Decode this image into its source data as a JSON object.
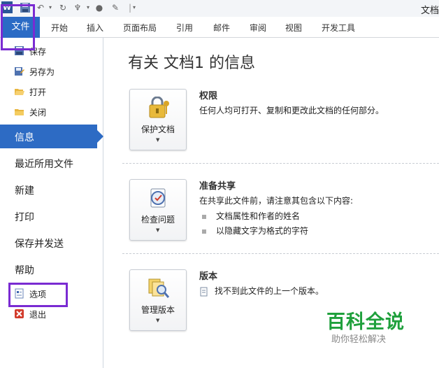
{
  "qat": {
    "icons": [
      "word-logo",
      "save-icon",
      "undo-icon",
      "redo-icon",
      "format-painter-icon",
      "dot-icon",
      "draw-icon",
      "customize-icon"
    ],
    "app_logo_letter": "W",
    "title_fragment": "文档"
  },
  "tabs": {
    "file": "文件",
    "home": "开始",
    "insert": "插入",
    "page_layout": "页面布局",
    "references": "引用",
    "mailings": "邮件",
    "review": "审阅",
    "view": "视图",
    "developer": "开发工具"
  },
  "nav": {
    "save": "保存",
    "save_as": "另存为",
    "open": "打开",
    "close": "关闭",
    "info": "信息",
    "recent": "最近所用文件",
    "new": "新建",
    "print": "打印",
    "save_send": "保存并发送",
    "help": "帮助",
    "options": "选项",
    "exit": "退出"
  },
  "main": {
    "title": "有关 文档1 的信息",
    "permissions": {
      "button": "保护文档",
      "title": "权限",
      "desc": "任何人均可打开、复制和更改此文档的任何部分。"
    },
    "prepare": {
      "button": "检查问题",
      "title": "准备共享",
      "desc": "在共享此文件前，请注意其包含以下内容:",
      "bullets": [
        "文档属性和作者的姓名",
        "以隐藏文字为格式的字符"
      ]
    },
    "versions": {
      "button": "管理版本",
      "title": "版本",
      "desc": "找不到此文件的上一个版本。"
    }
  },
  "watermark": {
    "title": "百科全说",
    "subtitle": "助你轻松解决"
  },
  "colors": {
    "accent": "#2b6bc5",
    "highlight": "#7a2bd2",
    "watermark": "#1fa03c"
  }
}
